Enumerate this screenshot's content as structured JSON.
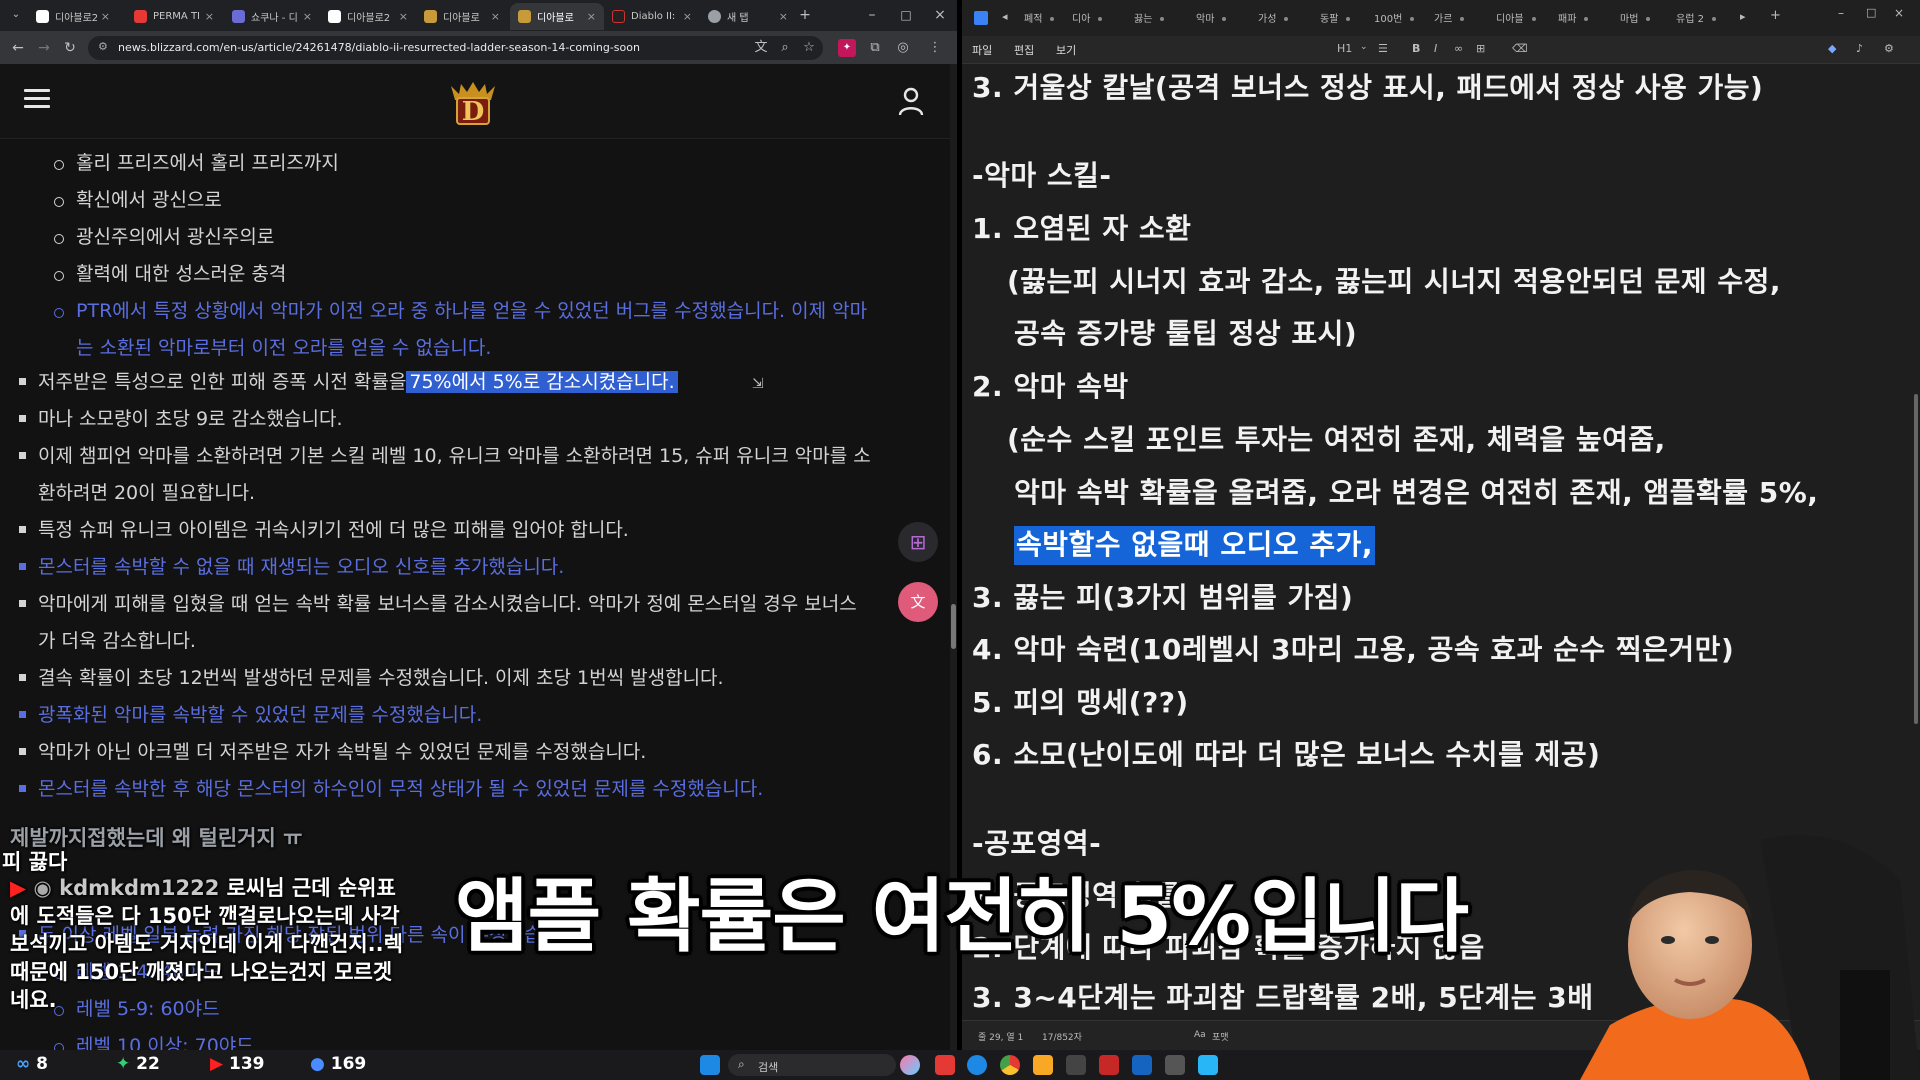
{
  "left_browser": {
    "tabs": [
      {
        "label": "디아블로2"
      },
      {
        "label": "PERMA TI"
      },
      {
        "label": "쇼쿠나 - 디"
      },
      {
        "label": "디아블로2"
      },
      {
        "label": "디아블로"
      },
      {
        "label": "디아블로"
      },
      {
        "label": "Diablo II:"
      },
      {
        "label": "새 탭"
      }
    ],
    "url": "news.blizzard.com/en-us/article/24261478/diablo-ii-resurrected-ladder-season-14-coming-soon",
    "logo_letter": "D"
  },
  "article": {
    "lines": [
      {
        "text": "홀리 프리즈에서 홀리 프리즈까지"
      },
      {
        "text": "확신에서 광신으로"
      },
      {
        "text": "광신주의에서 광신주의로"
      },
      {
        "text": "활력에 대한 성스러운 충격"
      },
      {
        "text": "PTR에서 특정 상황에서 악마가 이전 오라 중 하나를 얻을 수 있었던 버그를 수정했습니다. 이제 악마"
      },
      {
        "text": "는 소환된 악마로부터 이전 오라를 얻을 수 없습니다."
      },
      {
        "text": "저주받은 특성으로 인한 피해 증폭 시전 확률을",
        "sel": "75%에서 5%로 감소시켰습니다."
      },
      {
        "text": "마나 소모량이 초당 9로 감소했습니다."
      },
      {
        "text": "이제 챔피언 악마를 소환하려면 기본 스킬 레벨 10, 유니크 악마를 소환하려면 15, 슈퍼 유니크 악마를 소"
      },
      {
        "text": "환하려면 20이 필요합니다."
      },
      {
        "text": "특정 슈퍼 유니크 아이템은 귀속시키기 전에 더 많은 피해를 입어야 합니다."
      },
      {
        "text": "몬스터를 속박할 수 없을 때 재생되는 오디오 신호를 추가했습니다."
      },
      {
        "text": "악마에게 피해를 입혔을 때 얻는 속박 확률 보너스를 감소시켰습니다. 악마가 정예 몬스터일 경우 보너스"
      },
      {
        "text": "가 더욱 감소합니다."
      },
      {
        "text": "결속 확률이 초당 12번씩 발생하던 문제를 수정했습니다. 이제 초당 1번씩 발생합니다."
      },
      {
        "text": "광폭화된 악마를 속박할 수 있었던 문제를 수정했습니다."
      },
      {
        "text": "악마가 아닌 아크멜 더 저주받은 자가 속박될 수 있었던 문제를 수정했습니다."
      },
      {
        "text": "몬스터를 속박한 후 해당 몬스터의 하수인이 무적 상태가 될 수 있었던 문제를 수정했습니다."
      },
      {
        "text": "두 이상 레벨 일부 능력 가진 해당 장된 범위 다른 속이 수정했습니다."
      },
      {
        "text": "레벨 1-4: 40야드"
      },
      {
        "text": "레벨 5-9: 60야드"
      },
      {
        "text": "레벨 10 이상: 70야드"
      }
    ]
  },
  "right_editor": {
    "tabs": [
      "폐적",
      "디아",
      "끓는",
      "악마",
      "가성",
      "동팔",
      "100번",
      "가르",
      "디아블",
      "패파",
      "마법",
      "유럽 2"
    ],
    "menu": [
      "파일",
      "편집",
      "보기"
    ],
    "heading_control": "H1",
    "lines": [
      {
        "text": "3. 거울상 칼날(공격 보너스 정상 표시, 패드에서 정상 사용 가능)"
      },
      {
        "text": "-악마 스킬-"
      },
      {
        "text": "1. 오염된 자 소환"
      },
      {
        "text": "(끓는피 시너지 효과 감소, 끓는피 시너지 적용안되던 문제 수정,"
      },
      {
        "text": "공속 증가량 툴팁 정상 표시)"
      },
      {
        "text": "2. 악마 속박"
      },
      {
        "text": "(순수 스킬 포인트 투자는 여전히 존재, 체력을 높여줌,"
      },
      {
        "text": "악마 속박 확률을 올려줌, 오라 변경은 여전히 존재, 앰플확률 5%,"
      },
      {
        "text": "",
        "sel": "속박할수 없을때 오디오 추가,"
      },
      {
        "text": "3. 끓는 피(3가지 범위를 가짐)"
      },
      {
        "text": "4. 악마 숙련(10레벨시 3마리 고용, 공속 효과 순수 찍은거만)"
      },
      {
        "text": "5. 피의 맹세(??)"
      },
      {
        "text": "6. 소모(난이도에 따라 더 많은 보너스 수치를 제공)"
      },
      {
        "text": "-공포영역-"
      },
      {
        "text": "1. 공포영역 확률"
      },
      {
        "text": "2. 단계에 따라 파괴참 확률 증가하지 않음"
      },
      {
        "text": "3. 3~4단계는 파괴참 드랍확률 2배, 5단계는 3배"
      }
    ],
    "status": {
      "position": "줄 29, 열 1",
      "chars": "17/852자",
      "zoom": "포맷"
    }
  },
  "taskbar": {
    "search_label": "검색"
  },
  "stream": {
    "stats": [
      {
        "value": "8"
      },
      {
        "value": "22"
      },
      {
        "value": "139"
      },
      {
        "value": "169"
      }
    ],
    "chat": {
      "faded": "제발까지접했는데 왜 털린거지 ㅠ",
      "prefix": "피 끓다",
      "username": "kdmkdm1222",
      "lines": [
        "로씨님 근데 순위표",
        "에 도적들은 다 150단 깬걸로나오는데 사각",
        "보석끼고 아템도 거지인데 이게 다깬건지..렉",
        "때문에 150단 깨졌다고 나오는건지 모르겟",
        "네요."
      ]
    },
    "subtitle": "앰플 확률은 여전히 5%입니다"
  }
}
